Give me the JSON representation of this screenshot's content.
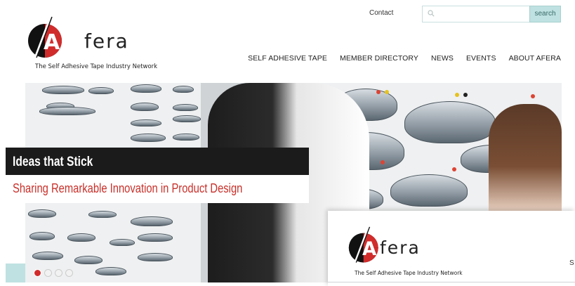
{
  "header": {
    "brand": "fera",
    "tagline": "The Self Adhesive Tape Industry Network",
    "contact_label": "Contact",
    "search_placeholder": "",
    "search_button": "search"
  },
  "nav": {
    "items": [
      {
        "label": "SELF ADHESIVE TAPE"
      },
      {
        "label": "MEMBER DIRECTORY"
      },
      {
        "label": "NEWS"
      },
      {
        "label": "EVENTS"
      },
      {
        "label": "ABOUT AFERA"
      }
    ]
  },
  "hero": {
    "title": "Ideas that Stick",
    "subtitle": "Sharing Remarkable Innovation in Product Design",
    "slides_total": 4,
    "active_slide": 1
  },
  "overlay": {
    "brand": "fera",
    "tagline": "The Self Adhesive Tape Industry Network",
    "edge_text": "S"
  },
  "colors": {
    "accent_red": "#d12c2c",
    "subtitle_red": "#c8312b",
    "teal": "#bfe1e1",
    "dark": "#1b1b1b"
  }
}
